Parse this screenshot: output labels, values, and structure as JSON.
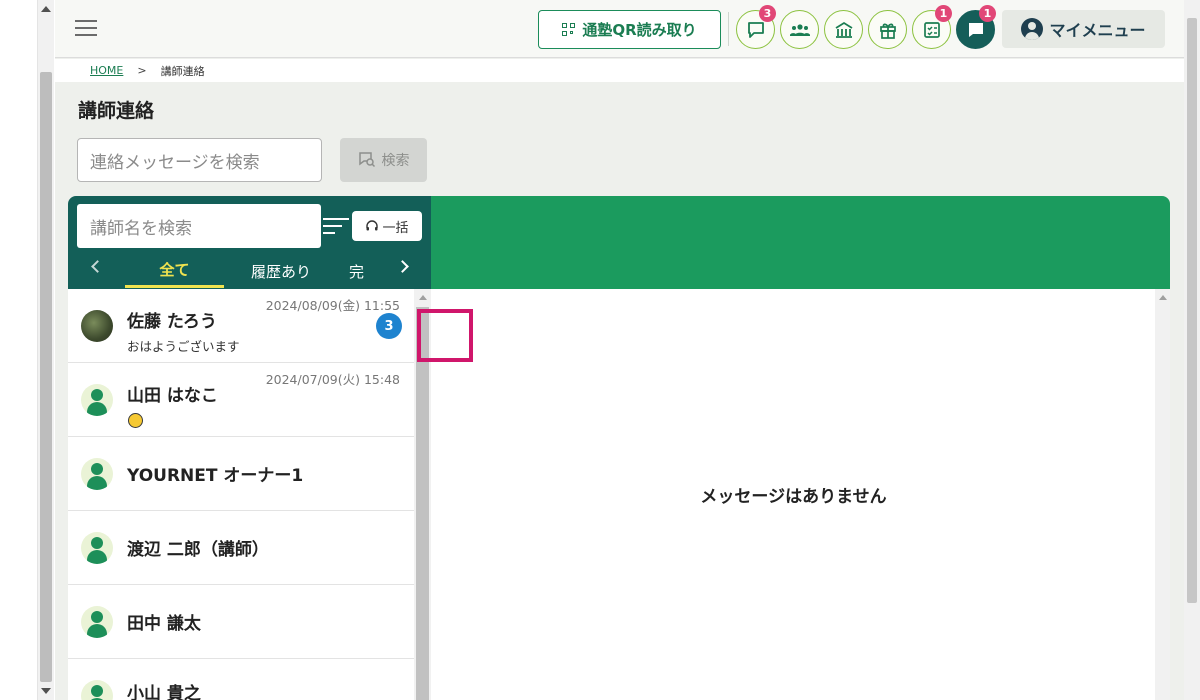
{
  "header": {
    "qr_button_label": "通塾QR読み取り",
    "my_menu_label": "マイメニュー",
    "icons": [
      {
        "name": "chat-bubble-icon",
        "badge": "3"
      },
      {
        "name": "group-icon",
        "badge": ""
      },
      {
        "name": "school-icon",
        "badge": ""
      },
      {
        "name": "gift-icon",
        "badge": ""
      },
      {
        "name": "checklist-icon",
        "badge": "1"
      },
      {
        "name": "message-icon",
        "badge": "1"
      }
    ]
  },
  "breadcrumb": {
    "home": "HOME",
    "separator": ">",
    "current": "講師連絡"
  },
  "page_title": "講師連絡",
  "message_search": {
    "placeholder": "連絡メッセージを検索",
    "button_label": "検索"
  },
  "teacher_search": {
    "placeholder": "講師名を検索"
  },
  "bulk_button_label": "一括",
  "tabs": [
    {
      "label": "全て",
      "active": true
    },
    {
      "label": "履歴あり",
      "active": false
    },
    {
      "label": "完",
      "active": false
    }
  ],
  "teachers": [
    {
      "name": "佐藤 たろう",
      "date": "2024/08/09(金) 11:55",
      "preview": "おはようございます",
      "unread": "3",
      "avatar": "photo"
    },
    {
      "name": "山田 はなこ",
      "date": "2024/07/09(火) 15:48",
      "preview": "",
      "unread": "",
      "avatar": "default",
      "emoji": true
    },
    {
      "name": "YOURNET オーナー1",
      "date": "",
      "preview": "",
      "unread": "",
      "avatar": "default"
    },
    {
      "name": "渡辺 二郎（講師）",
      "date": "",
      "preview": "",
      "unread": "",
      "avatar": "default"
    },
    {
      "name": "田中 謙太",
      "date": "",
      "preview": "",
      "unread": "",
      "avatar": "default"
    },
    {
      "name": "小山 貴之",
      "date": "",
      "preview": "",
      "unread": "",
      "avatar": "default"
    }
  ],
  "empty_message": "メッセージはありません",
  "colors": {
    "primary_green": "#1b9b5e",
    "dark_teal": "#135f58",
    "badge_pink": "#e14777",
    "unread_blue": "#1e83cf",
    "highlight_magenta": "#d0166b"
  }
}
